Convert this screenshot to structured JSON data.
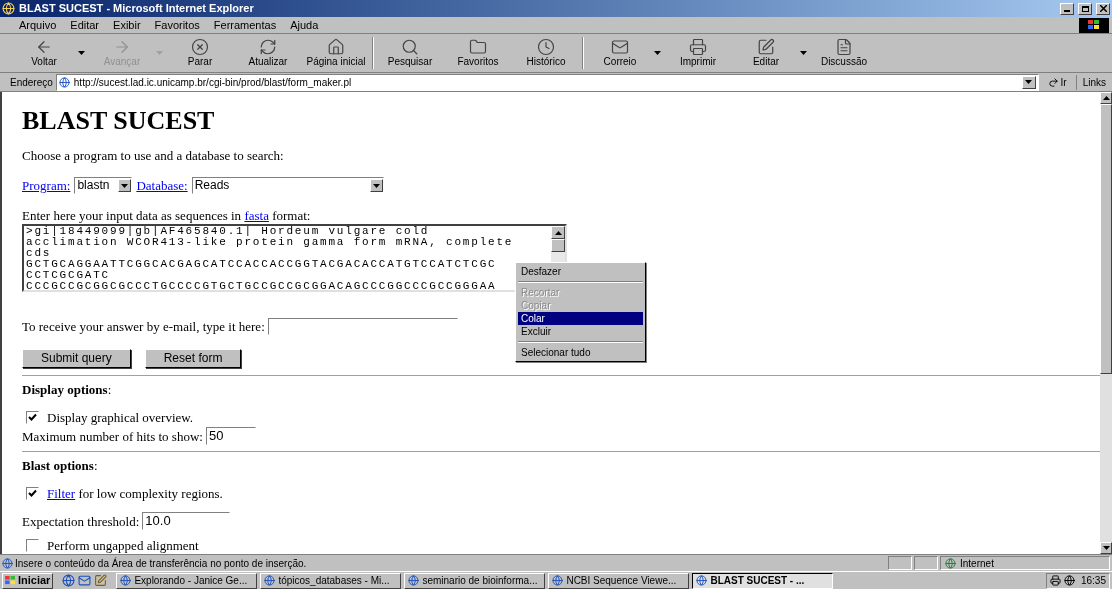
{
  "window": {
    "title": "BLAST SUCEST - Microsoft Internet Explorer"
  },
  "menu": [
    "Arquivo",
    "Editar",
    "Exibir",
    "Favoritos",
    "Ferramentas",
    "Ajuda"
  ],
  "toolbar": [
    {
      "kind": "button",
      "label": "Voltar",
      "disabled": false,
      "dropdown": true
    },
    {
      "kind": "button",
      "label": "Avançar",
      "disabled": true,
      "dropdown": true
    },
    {
      "kind": "button",
      "label": "Parar",
      "disabled": false,
      "dropdown": false
    },
    {
      "kind": "button",
      "label": "Atualizar",
      "disabled": false,
      "dropdown": false
    },
    {
      "kind": "button",
      "label": "Página inicial",
      "disabled": false,
      "dropdown": false
    },
    {
      "kind": "separator"
    },
    {
      "kind": "button",
      "label": "Pesquisar",
      "disabled": false,
      "dropdown": false
    },
    {
      "kind": "button",
      "label": "Favoritos",
      "disabled": false,
      "dropdown": false
    },
    {
      "kind": "button",
      "label": "Histórico",
      "disabled": false,
      "dropdown": false
    },
    {
      "kind": "separator"
    },
    {
      "kind": "button",
      "label": "Correio",
      "disabled": false,
      "dropdown": true
    },
    {
      "kind": "button",
      "label": "Imprimir",
      "disabled": false,
      "dropdown": false
    },
    {
      "kind": "button",
      "label": "Editar",
      "disabled": false,
      "dropdown": true
    },
    {
      "kind": "button",
      "label": "Discussão",
      "disabled": false,
      "dropdown": false
    }
  ],
  "address_bar": {
    "label": "Endereço",
    "value": "http://sucest.lad.ic.unicamp.br/cgi-bin/prod/blast/form_maker.pl",
    "go": "Ir",
    "links": "Links"
  },
  "page": {
    "heading": "BLAST SUCEST",
    "intro": "Choose a program to use and a database to search:",
    "program": {
      "label": "Program:",
      "value": "blastn"
    },
    "database": {
      "label": "Database:",
      "value": "Reads"
    },
    "sequence_prompt": {
      "before": "Enter here your input data as sequences in ",
      "link": "fasta",
      "after": " format:"
    },
    "sequence_lines": [
      ">gi|18449099|gb|AF465840.1| Hordeum vulgare cold",
      "acclimation WCOR413-like protein gamma form mRNA, complete",
      "cds",
      "GCTGCAGGAATTCGGCACGAGCATCCACCACCGGTACGACACCATGTCCATCTCGC",
      "CCTCGCGATC",
      "CCCGCCGCGGCGCCCTGCCCCGTGCTGCCGCCGCGGACAGCCCGGCCCGCCGGGAA"
    ],
    "email": {
      "label": "To receive your answer by e-mail, type it here:"
    },
    "buttons": [
      "Submit query",
      "Reset form"
    ],
    "display_options": {
      "title": "**Display options**:",
      "graphical_overview": {
        "label": "Display graphical overview.",
        "checked": true
      },
      "max_hits": {
        "label": "Maximum number of hits to show:",
        "value": "50"
      }
    },
    "blast_options": {
      "title": "**Blast options**:",
      "filter": {
        "link": "Filter",
        "label": " for low complexity regions.",
        "checked": true
      },
      "expectation": {
        "label": "Expectation threshold:",
        "value": "10.0"
      },
      "ungapped": {
        "label": "Perform ungapped alignment",
        "checked": false
      }
    }
  },
  "context_menu": [
    {
      "kind": "item",
      "label": "Desfazer",
      "disabled": false,
      "selected": false
    },
    {
      "kind": "separator"
    },
    {
      "kind": "item",
      "label": "Recortar",
      "disabled": true,
      "selected": false
    },
    {
      "kind": "item",
      "label": "Copiar",
      "disabled": true,
      "selected": false
    },
    {
      "kind": "item",
      "label": "Colar",
      "disabled": false,
      "selected": true
    },
    {
      "kind": "item",
      "label": "Excluir",
      "disabled": false,
      "selected": false
    },
    {
      "kind": "separator"
    },
    {
      "kind": "item",
      "label": "Selecionar tudo",
      "disabled": false,
      "selected": false
    }
  ],
  "status_bar": {
    "text": "Insere o conteúdo da Área de transferência no ponto de inserção.",
    "zone": "Internet"
  },
  "taskbar": {
    "start": "Iniciar",
    "tasks": [
      {
        "label": "Explorando - Janice Ge...",
        "selected": false
      },
      {
        "label": "tópicos_databases - Mi...",
        "selected": false
      },
      {
        "label": "seminario de bioinforma...",
        "selected": false
      },
      {
        "label": "NCBI Sequence Viewe...",
        "selected": false
      },
      {
        "label": "BLAST SUCEST - ...",
        "selected": true
      }
    ],
    "clock": "16:35"
  }
}
